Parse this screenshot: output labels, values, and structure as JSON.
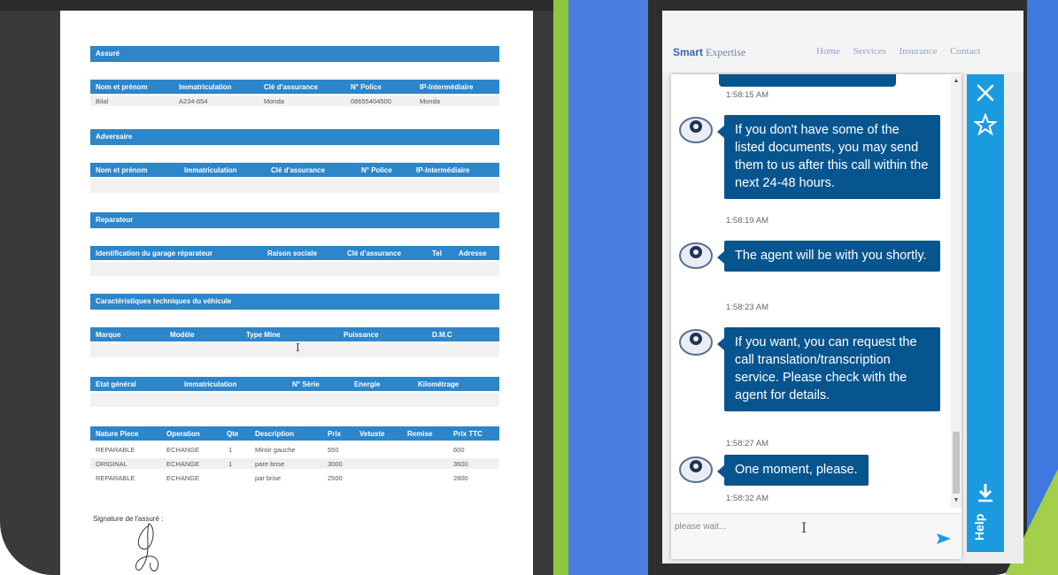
{
  "document": {
    "assure": {
      "title": "Assuré",
      "headers": [
        "Nom et prénom",
        "Immatriculation",
        "Clé d'assurance",
        "N° Police",
        "IP-Intermédiaire"
      ],
      "row": [
        "Bilal",
        "A234-654",
        "Monda",
        "08655404500",
        "Monda"
      ]
    },
    "adversaire": {
      "title": "Adversaire",
      "headers": [
        "Nom et prénom",
        "Immatriculation",
        "Clé d'assurance",
        "N° Police",
        "IP-Intermédiaire"
      ]
    },
    "reparateur": {
      "title": "Reparateur",
      "headers": [
        "Identification du garage réparateur",
        "Raison sociale",
        "Clé d'assurance",
        "Tel",
        "Adresse"
      ]
    },
    "vehicule": {
      "title": "Caractéristiques techniques du véhicule",
      "headers": [
        "Marque",
        "Modèle",
        "Type Mine",
        "Puissance",
        "D.M.C"
      ]
    },
    "etat": {
      "headers": [
        "Etat général",
        "Immatriculation",
        "N° Série",
        "Energie",
        "Kilométrage"
      ]
    },
    "pieces": {
      "headers": [
        "Nature Piece",
        "Operation",
        "Qte",
        "Description",
        "Prix",
        "Vetuste",
        "Remise",
        "Prix TTC"
      ],
      "rows": [
        [
          "REPARABLE",
          "ECHANGE",
          "1",
          "Miroir gauche",
          "550",
          "",
          "",
          "600"
        ],
        [
          "ORIGINAL",
          "ECHANGE",
          "1",
          "pare brise",
          "3000",
          "",
          "",
          "3600"
        ],
        [
          "REPARABLE",
          "ECHANGE",
          "",
          "par brise",
          "2500",
          "",
          "",
          "2800"
        ]
      ]
    },
    "signature_label": "Signature de l'assuré :"
  },
  "site": {
    "brand_bold": "Smart",
    "brand_rest": " Expertise",
    "nav": [
      "Home",
      "Services",
      "Insurance",
      "Contact"
    ]
  },
  "chat": {
    "first_timestamp": "1:58:15 AM",
    "messages": [
      {
        "text": "If you don't have some of the listed documents, you may send them to us after this call within the next 24-48 hours.",
        "time": "1:58:19 AM"
      },
      {
        "text": "The agent will be with you shortly.",
        "time": "1:58:23 AM"
      },
      {
        "text": "If you want, you can request the call translation/transcription service. Please check with the agent for details.",
        "time": "1:58:27 AM"
      },
      {
        "text": "One moment, please.",
        "time": "1:58:32 AM"
      }
    ],
    "input_placeholder": "please wait...",
    "help_label": "Help"
  },
  "colors": {
    "doc_header": "#2d86c9",
    "bubble": "#07558f",
    "help_rail": "#1a9be0",
    "brand": "#3b64b2"
  },
  "icons": {
    "close": "close-icon",
    "star": "star-icon",
    "download": "download-icon",
    "send": "send-icon",
    "avatar": "agent-avatar-icon"
  }
}
